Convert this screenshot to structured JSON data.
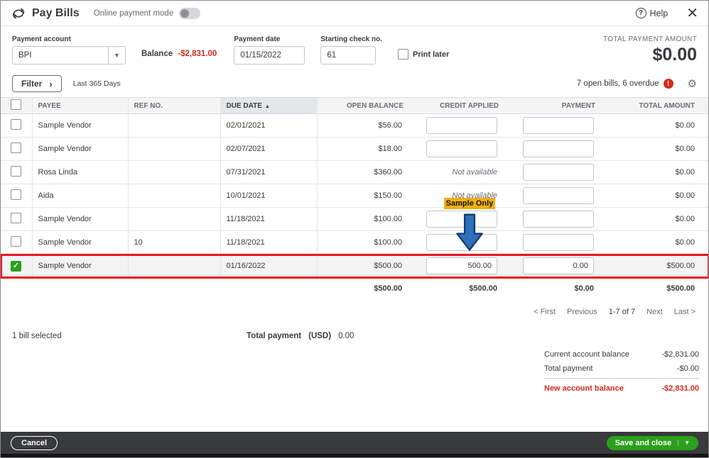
{
  "header": {
    "title": "Pay Bills",
    "online_payment_label": "Online payment mode",
    "help_label": "Help"
  },
  "form": {
    "payment_account_label": "Payment account",
    "payment_account_value": "BPI",
    "balance_label": "Balance",
    "balance_value": "-$2,831.00",
    "payment_date_label": "Payment date",
    "payment_date_value": "01/15/2022",
    "starting_check_label": "Starting check no.",
    "starting_check_value": "61",
    "print_later_label": "Print later",
    "total_payment_amount_label": "TOTAL PAYMENT AMOUNT",
    "total_payment_amount_value": "$0.00"
  },
  "filter_bar": {
    "filter_label": "Filter",
    "date_range": "Last 365 Days",
    "open_bills_summary": "7 open bills, 6 overdue"
  },
  "table": {
    "columns": {
      "payee": "PAYEE",
      "ref_no": "REF NO.",
      "due_date": "DUE DATE",
      "open_balance": "OPEN BALANCE",
      "credit_applied": "CREDIT APPLIED",
      "payment": "PAYMENT",
      "total_amount": "TOTAL AMOUNT"
    },
    "not_available_label": "Not available",
    "rows": [
      {
        "payee": "Sample Vendor",
        "ref_no": "",
        "due_date": "02/01/2021",
        "open_balance": "$56.00",
        "credit_applied": "",
        "credit_na": false,
        "payment": "",
        "total_amount": "$0.00",
        "checked": false,
        "selected": false
      },
      {
        "payee": "Sample Vendor",
        "ref_no": "",
        "due_date": "02/07/2021",
        "open_balance": "$18.00",
        "credit_applied": "",
        "credit_na": false,
        "payment": "",
        "total_amount": "$0.00",
        "checked": false,
        "selected": false
      },
      {
        "payee": "Rosa Linda",
        "ref_no": "",
        "due_date": "07/31/2021",
        "open_balance": "$360.00",
        "credit_applied": "",
        "credit_na": true,
        "payment": "",
        "total_amount": "$0.00",
        "checked": false,
        "selected": false
      },
      {
        "payee": "Aida",
        "ref_no": "",
        "due_date": "10/01/2021",
        "open_balance": "$150.00",
        "credit_applied": "",
        "credit_na": true,
        "payment": "",
        "total_amount": "$0.00",
        "checked": false,
        "selected": false
      },
      {
        "payee": "Sample Vendor",
        "ref_no": "",
        "due_date": "11/18/2021",
        "open_balance": "$100.00",
        "credit_applied": "",
        "credit_na": false,
        "payment": "",
        "total_amount": "$0.00",
        "checked": false,
        "selected": false
      },
      {
        "payee": "Sample Vendor",
        "ref_no": "10",
        "due_date": "11/18/2021",
        "open_balance": "$100.00",
        "credit_applied": "",
        "credit_na": false,
        "payment": "",
        "total_amount": "$0.00",
        "checked": false,
        "selected": false
      },
      {
        "payee": "Sample Vendor",
        "ref_no": "",
        "due_date": "01/16/2022",
        "open_balance": "$500.00",
        "credit_applied": "500.00",
        "credit_na": false,
        "payment": "0.00",
        "total_amount": "$500.00",
        "checked": true,
        "selected": true
      }
    ],
    "totals": {
      "open_balance": "$500.00",
      "credit_applied": "$500.00",
      "payment": "$0.00",
      "total_amount": "$500.00"
    }
  },
  "annotation": {
    "badge_label": "Sample Only"
  },
  "pagination": {
    "first": "< First",
    "previous": "Previous",
    "range": "1-7 of 7",
    "next": "Next",
    "last": "Last >"
  },
  "selection_summary": {
    "bills_selected": "1 bill selected",
    "total_payment_label": "Total payment",
    "currency_label": "(USD)",
    "total_payment_value": "0.00"
  },
  "account_summary": {
    "current_balance_label": "Current account balance",
    "current_balance_value": "-$2,831.00",
    "total_payment_label": "Total payment",
    "total_payment_value": "-$0.00",
    "new_balance_label": "New account balance",
    "new_balance_value": "-$2,831.00"
  },
  "footer": {
    "cancel_label": "Cancel",
    "save_label": "Save and close"
  },
  "colors": {
    "accent_green": "#2ca01c",
    "negative_red": "#d52b1e",
    "annotation_red": "#e8151d",
    "badge_yellow": "#efaf13",
    "arrow_blue": "#2e6fba"
  }
}
